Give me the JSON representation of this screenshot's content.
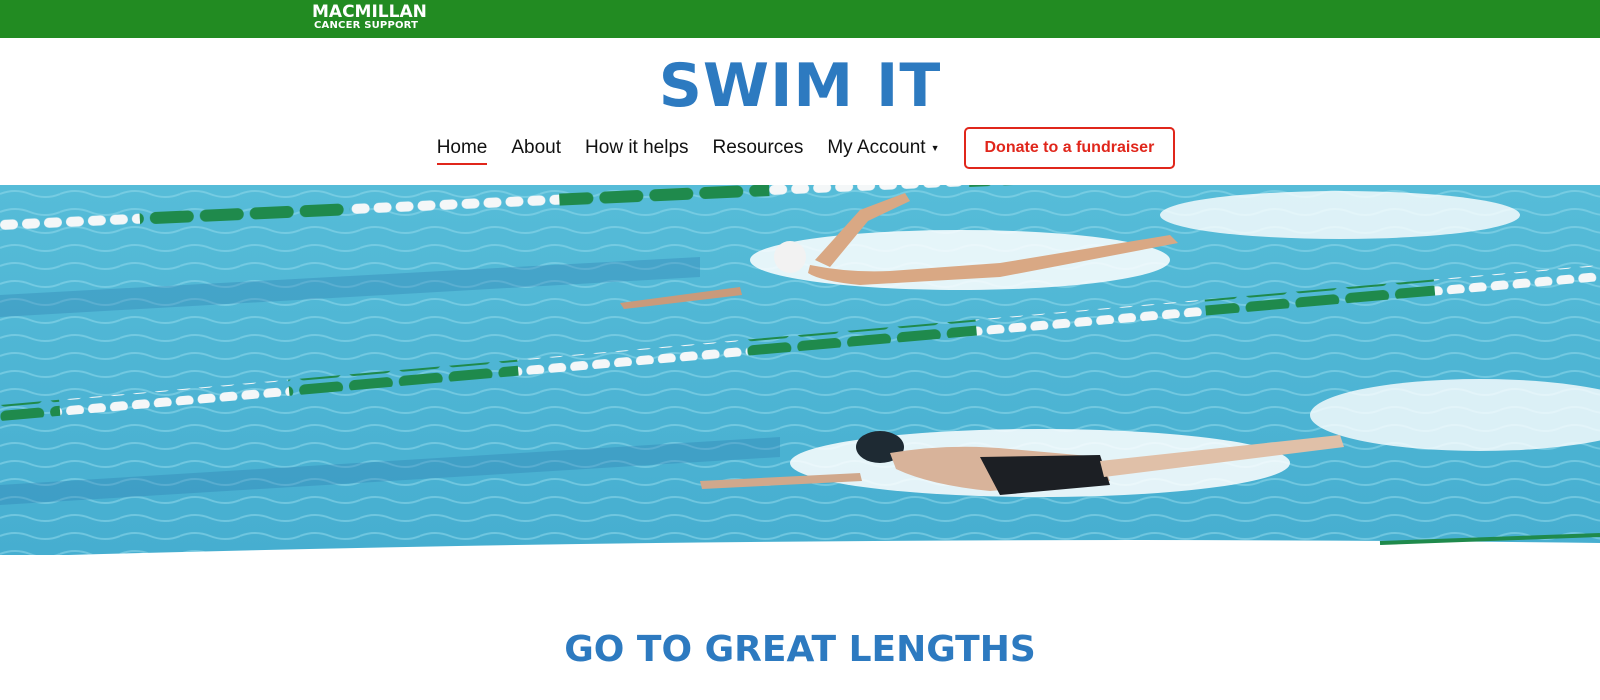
{
  "brand": {
    "logo_line1": "MACMILLAN",
    "logo_line2": "CANCER SUPPORT",
    "topbar_color": "#228b22"
  },
  "site_title": "SWIM IT",
  "nav": {
    "items": [
      {
        "label": "Home",
        "active": true
      },
      {
        "label": "About"
      },
      {
        "label": "How it helps"
      },
      {
        "label": "Resources"
      },
      {
        "label": "My Account",
        "has_dropdown": true
      }
    ],
    "donate_label": "Donate to a fundraiser"
  },
  "hero": {
    "image": "swimmers-in-pool"
  },
  "section": {
    "heading": "GO TO GREAT LENGTHS"
  },
  "colors": {
    "accent_blue": "#2d7ac0",
    "accent_red": "#e0261b",
    "pool": "#4fb6d3"
  }
}
